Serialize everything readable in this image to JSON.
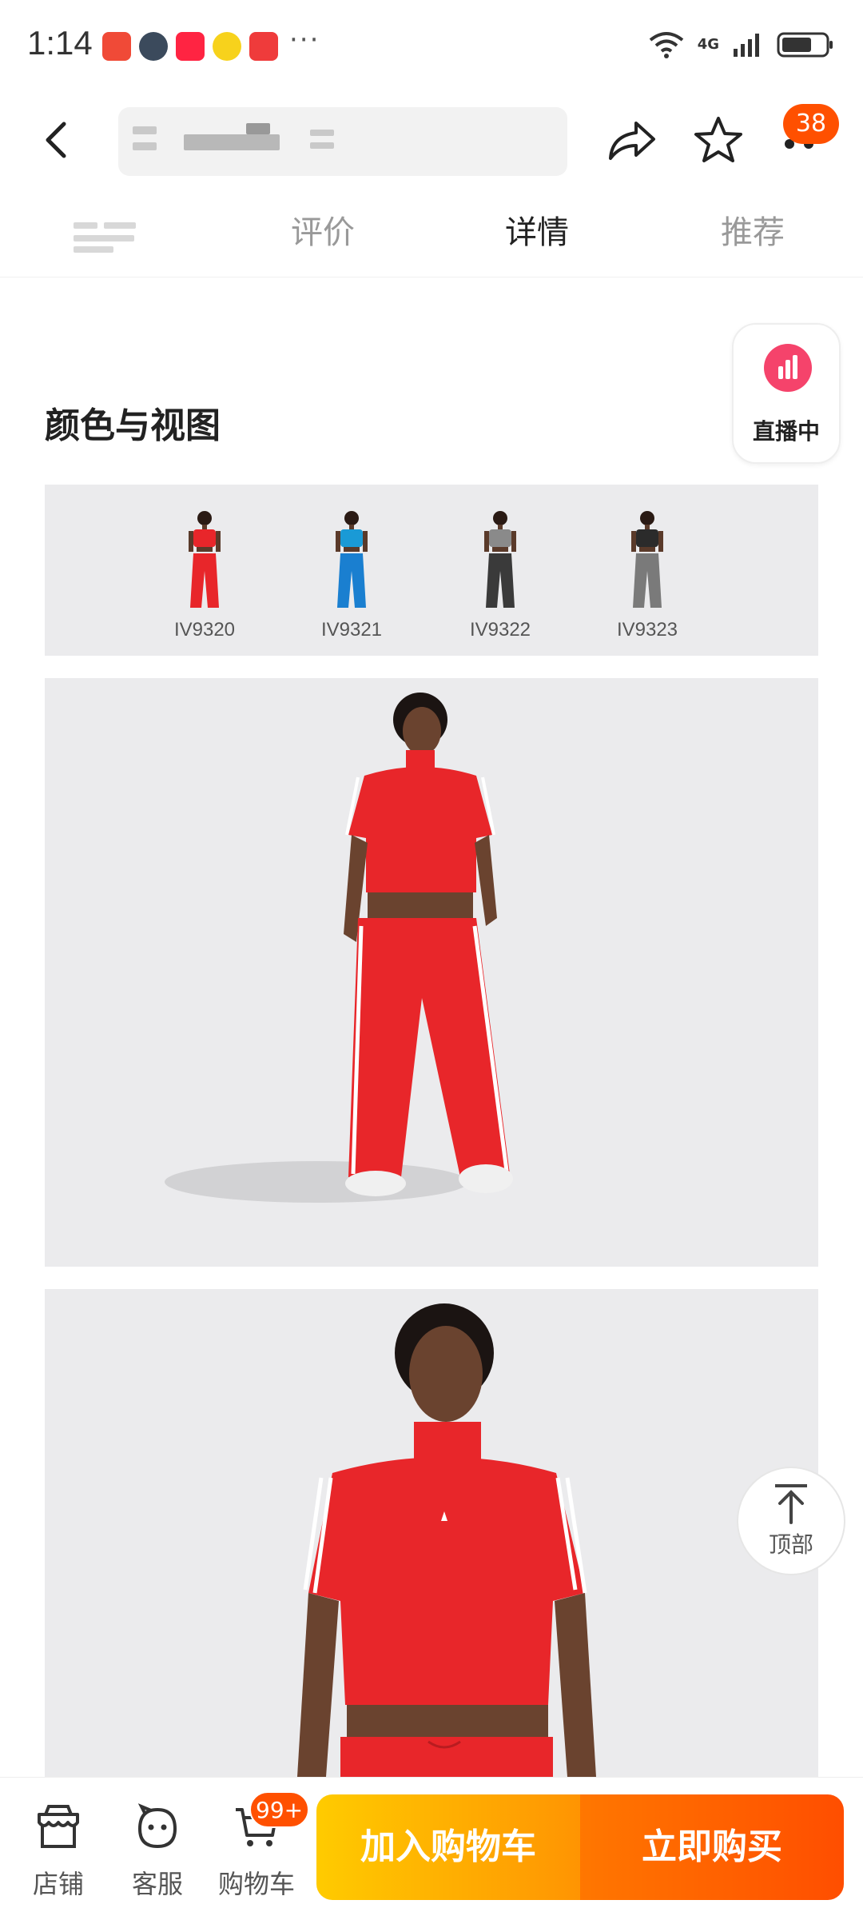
{
  "status_bar": {
    "time": "1:14",
    "network": "4G",
    "notification_icons": [
      "missed-call-icon",
      "avatar-icon",
      "xiaohongshu-icon",
      "weibo-icon",
      "message-icon"
    ],
    "more": "···"
  },
  "nav": {
    "back_icon": "back-arrow-icon",
    "share_icon": "share-icon",
    "favorite_icon": "star-icon",
    "cart_badge": "38"
  },
  "tabs": [
    {
      "label": "",
      "active": false
    },
    {
      "label": "评价",
      "active": false
    },
    {
      "label": "详情",
      "active": true
    },
    {
      "label": "推荐",
      "active": false
    }
  ],
  "live_badge": {
    "label": "直播中",
    "icon": "live-bars-icon"
  },
  "section": {
    "title": "颜色与视图"
  },
  "variants": [
    {
      "code": "IV9320",
      "color": "#e8262a",
      "pants": "#e8262a"
    },
    {
      "code": "IV9321",
      "color": "#1a9ad6",
      "pants": "#1a7fd0"
    },
    {
      "code": "IV9322",
      "color": "#8a8a8a",
      "pants": "#3a3a3a"
    },
    {
      "code": "IV9323",
      "color": "#2b2b2b",
      "pants": "#7a7a7a"
    }
  ],
  "back_to_top": {
    "label": "顶部",
    "icon": "arrow-up-icon"
  },
  "bottom_bar": {
    "store_label": "店铺",
    "service_label": "客服",
    "cart_label": "购物车",
    "cart_badge": "99+",
    "add_to_cart": "加入购物车",
    "buy_now": "立即购买"
  },
  "colors": {
    "accent": "#ff5000",
    "product_red": "#e8262a",
    "live_pink": "#f5436b"
  }
}
